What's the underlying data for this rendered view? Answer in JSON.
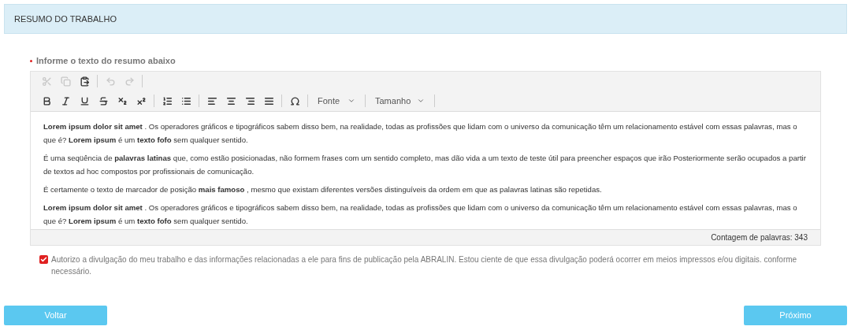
{
  "header": {
    "title": "RESUMO DO TRABALHO"
  },
  "field": {
    "label": "Informe o texto do resumo abaixo",
    "required": true
  },
  "toolbar": {
    "rows": [
      [
        {
          "kind": "cut",
          "disabled": true
        },
        {
          "kind": "copy",
          "disabled": true
        },
        {
          "kind": "paste",
          "disabled": false
        },
        {
          "kind": "sep"
        },
        {
          "kind": "undo",
          "disabled": true
        },
        {
          "kind": "redo",
          "disabled": true
        },
        {
          "kind": "sep"
        }
      ],
      [
        {
          "kind": "bold",
          "disabled": false
        },
        {
          "kind": "italic",
          "disabled": false
        },
        {
          "kind": "underline",
          "disabled": false
        },
        {
          "kind": "strike",
          "disabled": false
        },
        {
          "kind": "subscript",
          "disabled": false
        },
        {
          "kind": "superscript",
          "disabled": false
        },
        {
          "kind": "sep"
        },
        {
          "kind": "ordered-list",
          "disabled": false
        },
        {
          "kind": "bullet-list",
          "disabled": false
        },
        {
          "kind": "sep"
        },
        {
          "kind": "align-left",
          "disabled": false
        },
        {
          "kind": "align-center",
          "disabled": false
        },
        {
          "kind": "align-right",
          "disabled": false
        },
        {
          "kind": "justify",
          "disabled": false
        },
        {
          "kind": "sep"
        },
        {
          "kind": "omega",
          "disabled": false
        },
        {
          "kind": "sep"
        },
        {
          "kind": "dropdown",
          "label": "Fonte"
        },
        {
          "kind": "sep"
        },
        {
          "kind": "dropdown",
          "label": "Tamanho"
        },
        {
          "kind": "sep"
        }
      ]
    ]
  },
  "paragraphs": [
    "**Lorem ipsum dolor sit amet** . Os operadores gráficos e tipográficos sabem disso bem, na realidade, todas as profissões que lidam com o universo da comunicação têm um relacionamento estável com essas palavras, mas o que é? **Lorem ipsum** é um **texto fofo** sem qualquer sentido.",
    "É uma seqüência de **palavras latinas** que, como estão posicionadas, não formem frases com um sentido completo, mas dão vida a um texto de teste útil para preencher espaços que irão Posteriormente serão ocupados a partir de textos ad hoc compostos por profissionais de comunicação.",
    "É certamente o texto de marcador de posição **mais famoso** , mesmo que existam diferentes versões distinguíveis da ordem em que as palavras latinas são repetidas.",
    "**Lorem ipsum dolor sit amet** . Os operadores gráficos e tipográficos sabem disso bem, na realidade, todas as profissões que lidam com o universo da comunicação têm um relacionamento estável com essas palavras, mas o que é? **Lorem ipsum** é um **texto fofo** sem qualquer sentido."
  ],
  "word_count": "Contagem de palavras: 343",
  "consent": {
    "checked": true,
    "text": "Autorizo a divulgação do meu trabalho e das informações relacionadas a ele para fins de publicação pela ABRALIN. Estou ciente de que essa divulgação poderá ocorrer em meios impressos e/ou digitais. conforme necessário."
  },
  "buttons": [
    {
      "label": "Voltar"
    },
    {
      "label": "Próximo"
    }
  ]
}
